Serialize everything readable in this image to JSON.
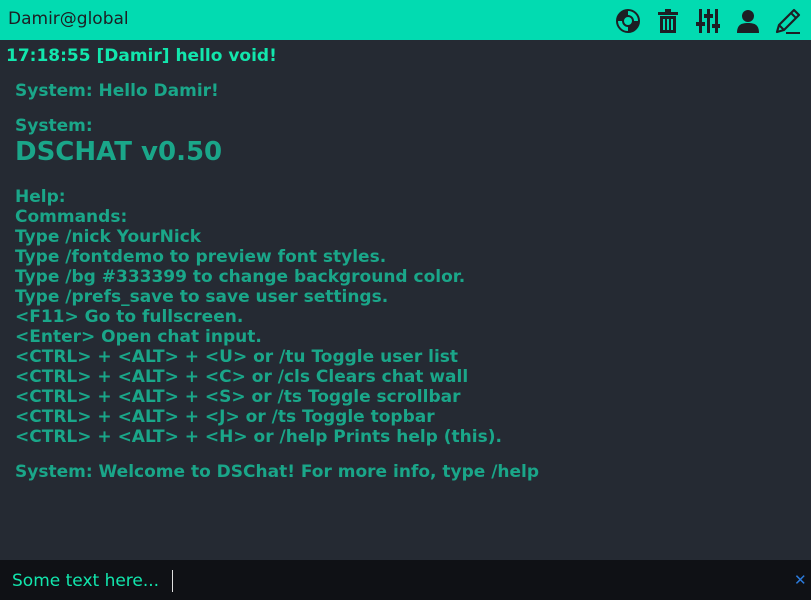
{
  "topbar": {
    "user_label": "Damir@global",
    "icons": [
      "lifebuoy-icon",
      "trash-icon",
      "sliders-icon",
      "user-icon",
      "pencil-icon"
    ],
    "background": "#02dbb1"
  },
  "chat": {
    "user_message": "17:18:55 [Damir] hello void!",
    "system_hello": "System: Hello Damir!",
    "system_label": "System:",
    "version_title": "DSCHAT v0.50",
    "help_lines": [
      "Help:",
      "Commands:",
      "Type /nick YourNick",
      "Type /fontdemo to preview font styles.",
      "Type /bg #333399 to change background color.",
      "Type /prefs_save to save user settings.",
      "<F11> Go to fullscreen.",
      "<Enter> Open chat input.",
      "<CTRL> + <ALT> + <U> or /tu Toggle user list",
      "<CTRL> + <ALT> + <C> or /cls Clears chat wall",
      "<CTRL> + <ALT> + <S> or /ts Toggle scrollbar",
      "<CTRL> + <ALT> + <J> or /ts Toggle topbar",
      "<CTRL> + <ALT> + <H> or /help Prints help (this)."
    ],
    "system_welcome": "System: Welcome to DSChat! For more info, type /help",
    "colors": {
      "background": "#252a33",
      "user_text": "#12e6ad",
      "system_text": "#1aa689"
    }
  },
  "input": {
    "value": "Some text here...",
    "close_symbol": "✕",
    "background": "#0f1115"
  }
}
